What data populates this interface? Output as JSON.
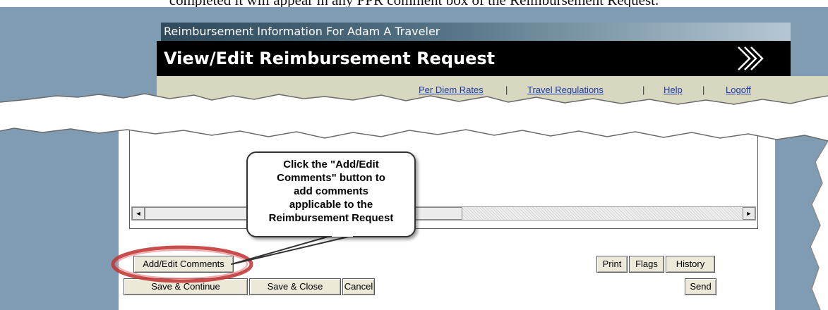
{
  "instruction_text": "completed it will appear in any PPR comment box of the Reimbursement Request.",
  "header": {
    "subtitle": "Reimbursement Information For Adam A Traveler",
    "title": "View/Edit Reimbursement Request"
  },
  "nav_links": [
    "Per Diem Rates",
    "Travel Regulations",
    "Help",
    "Logoff"
  ],
  "nav_separator": "|",
  "callout": {
    "lines": [
      "Click the \"Add/Edit",
      "Comments\" button to",
      "add comments",
      "applicable to the",
      "Reimbursement Request"
    ]
  },
  "scrollbar": {
    "left_arrow": "◄",
    "right_arrow": "►"
  },
  "buttons": {
    "add_edit_comments": "Add/Edit Comments",
    "save_continue": "Save & Continue",
    "save_close": "Save & Close",
    "cancel": "Cancel",
    "print": "Print",
    "flags": "Flags",
    "history": "History",
    "send": "Send"
  },
  "colors": {
    "frame": "#7f9cb3",
    "title_bar": "#000000",
    "link_bar": "#d8d8c0",
    "link": "#1e3aa8",
    "highlight_ring": "#c23a3a"
  }
}
